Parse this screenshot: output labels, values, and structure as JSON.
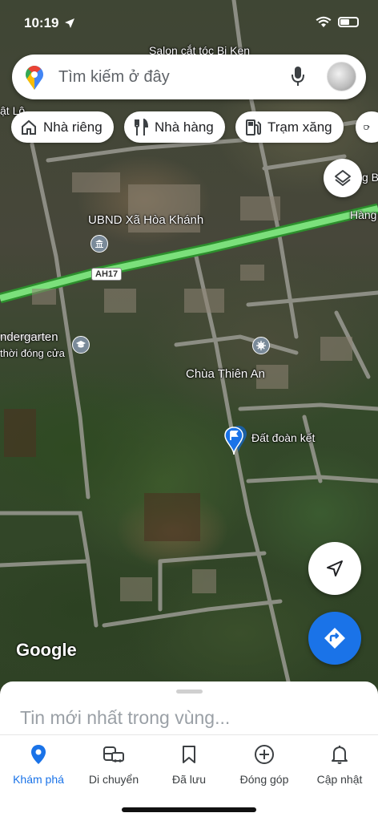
{
  "status_bar": {
    "time": "10:19"
  },
  "search": {
    "placeholder": "Tìm kiếm ở đây"
  },
  "chips": [
    {
      "label": "Nhà riêng",
      "icon": "home-icon"
    },
    {
      "label": "Nhà hàng",
      "icon": "restaurant-icon"
    },
    {
      "label": "Trạm xăng",
      "icon": "gas-station-icon"
    }
  ],
  "map": {
    "labels": {
      "salon": "Salon cắt tóc Bi Ken",
      "ubnd": "UBND Xã Hòa Khánh",
      "kindergarten": "ndergarten",
      "kindergarten_status": "thời đóng cửa",
      "temple": "Chùa Thiên An",
      "dat": "Đất đoàn kết",
      "road": "Hàng",
      "left_edge": "ật Lộ",
      "right_edge": "g B"
    },
    "highway_shield": "AH17",
    "google_logo": "Google"
  },
  "bottom_sheet": {
    "title": "Tin mới nhất trong vùng..."
  },
  "nav": {
    "items": [
      {
        "label": "Khám phá",
        "icon": "explore-pin-icon",
        "active": true
      },
      {
        "label": "Di chuyển",
        "icon": "commute-icon",
        "active": false
      },
      {
        "label": "Đã lưu",
        "icon": "bookmark-icon",
        "active": false
      },
      {
        "label": "Đóng góp",
        "icon": "add-circle-icon",
        "active": false
      },
      {
        "label": "Cập nhật",
        "icon": "bell-icon",
        "active": false
      }
    ]
  },
  "colors": {
    "accent": "#1a73e8",
    "highway": "#6fd36f"
  }
}
